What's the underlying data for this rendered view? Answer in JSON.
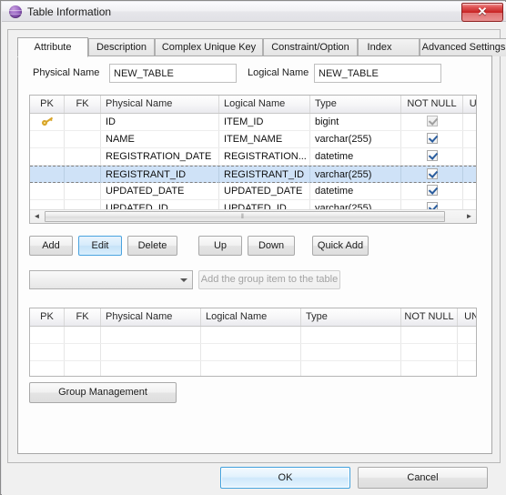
{
  "window": {
    "title": "Table Information",
    "icon": "table-sphere-icon",
    "close_label": "✕"
  },
  "tabs": [
    {
      "label": "Attribute",
      "active": true
    },
    {
      "label": "Description",
      "active": false
    },
    {
      "label": "Complex Unique Key",
      "active": false
    },
    {
      "label": "Constraint/Option",
      "active": false
    },
    {
      "label": "Index",
      "active": false
    },
    {
      "label": "Advanced Settings",
      "active": false
    }
  ],
  "name_fields": {
    "physical_label": "Physical Name",
    "physical_value": "NEW_TABLE",
    "logical_label": "Logical Name",
    "logical_value": "NEW_TABLE"
  },
  "attribute_grid": {
    "columns": [
      "PK",
      "FK",
      "Physical Name",
      "Logical Name",
      "Type",
      "NOT NULL",
      "UNIQU"
    ],
    "rows": [
      {
        "pk": "key-icon",
        "fk": "",
        "physical": "ID",
        "logical": "ITEM_ID",
        "type": "bigint",
        "not_null": "checked-disabled",
        "unique": "unchecked",
        "selected": false
      },
      {
        "pk": "",
        "fk": "",
        "physical": "NAME",
        "logical": "ITEM_NAME",
        "type": "varchar(255)",
        "not_null": "checked",
        "unique": "unchecked",
        "selected": false
      },
      {
        "pk": "",
        "fk": "",
        "physical": "REGISTRATION_DATE",
        "logical": "REGISTRATION...",
        "type": "datetime",
        "not_null": "checked",
        "unique": "unchecked",
        "selected": false
      },
      {
        "pk": "",
        "fk": "",
        "physical": "REGISTRANT_ID",
        "logical": "REGISTRANT_ID",
        "type": "varchar(255)",
        "not_null": "checked",
        "unique": "unchecked",
        "selected": true
      },
      {
        "pk": "",
        "fk": "",
        "physical": "UPDATED_DATE",
        "logical": "UPDATED_DATE",
        "type": "datetime",
        "not_null": "checked",
        "unique": "unchecked",
        "selected": false
      },
      {
        "pk": "",
        "fk": "",
        "physical": "UPDATED_ID",
        "logical": "UPDATED_ID",
        "type": "varchar(255)",
        "not_null": "checked",
        "unique": "unchecked",
        "selected": false
      }
    ],
    "scroll_left_arrow": "◄",
    "scroll_right_arrow": "►",
    "scroll_grip": "‖"
  },
  "action_buttons": {
    "add": "Add",
    "edit": "Edit",
    "delete": "Delete",
    "up": "Up",
    "down": "Down",
    "quick_add": "Quick Add"
  },
  "group_row": {
    "combo_value": "",
    "add_group_button": "Add the group item to the table"
  },
  "group_grid": {
    "columns": [
      "PK",
      "FK",
      "Physical Name",
      "Logical Name",
      "Type",
      "NOT NULL",
      "UNIQUE"
    ],
    "rows": []
  },
  "group_management_button": "Group Management",
  "dialog_buttons": {
    "ok": "OK",
    "cancel": "Cancel"
  }
}
